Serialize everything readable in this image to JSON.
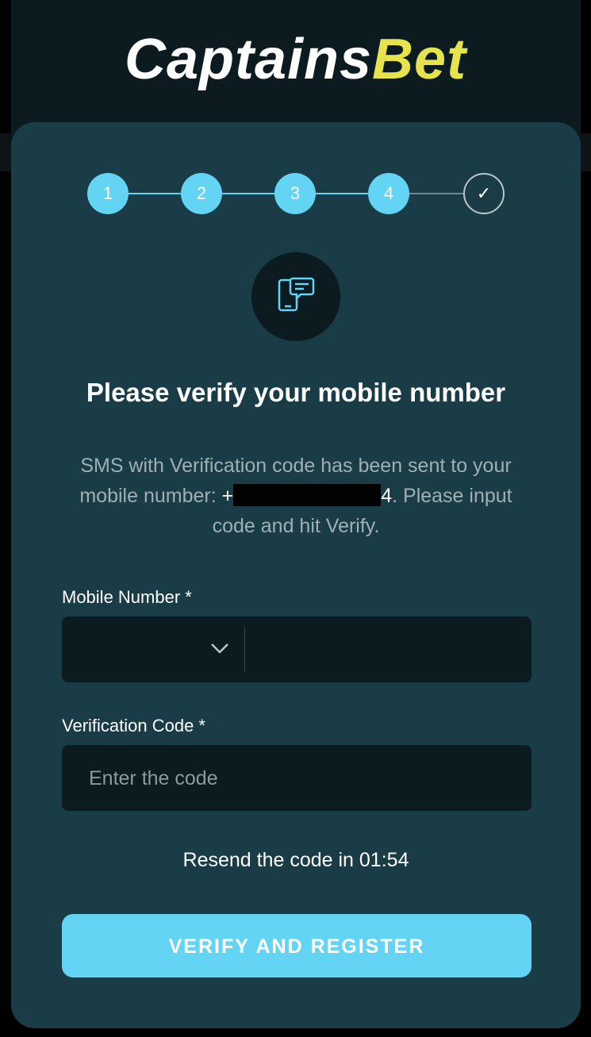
{
  "brand": {
    "logo_part1": "Captains",
    "logo_part2": "Bet"
  },
  "stepper": {
    "steps": [
      "1",
      "2",
      "3",
      "4"
    ],
    "final_step": "✓"
  },
  "heading": "Please verify your mobile number",
  "description": {
    "prefix": "SMS with Verification code has been sent to your mobile number: ",
    "number_start": "+",
    "number_end": "4",
    "suffix": ". Please input code and hit Verify."
  },
  "mobile": {
    "label": "Mobile Number *",
    "value": ""
  },
  "code": {
    "label": "Verification Code *",
    "placeholder": "Enter the code"
  },
  "resend_text": "Resend the code in 01:54",
  "verify_button": "VERIFY AND REGISTER",
  "colors": {
    "accent": "#63d4f3",
    "card": "#193c46",
    "field": "#0b1b20",
    "logo_yellow": "#e6e44a"
  }
}
